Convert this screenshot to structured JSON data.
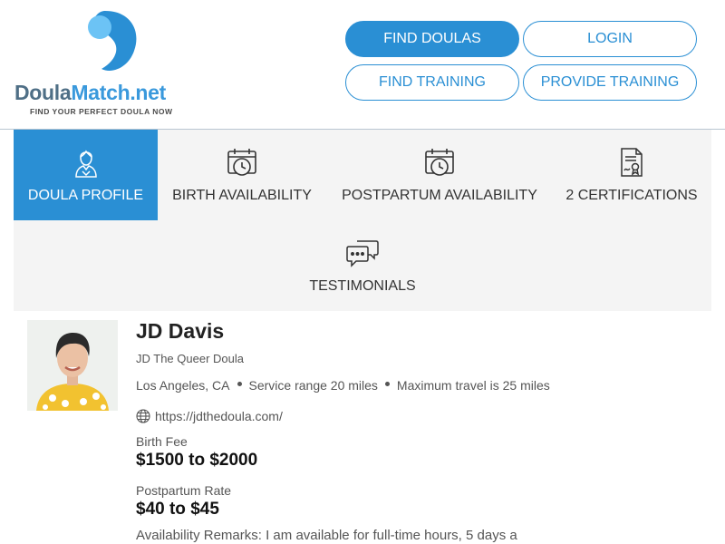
{
  "header": {
    "logo": {
      "name_part1": "Doula",
      "name_part2": "Match.net",
      "tagline": "FIND YOUR PERFECT DOULA NOW",
      "icon": "droplet-logo-icon"
    },
    "nav": {
      "find_doulas": "FIND DOULAS",
      "login": "LOGIN",
      "find_training": "FIND TRAINING",
      "provide_training": "PROVIDE TRAINING"
    }
  },
  "tabs": [
    {
      "label": "DOULA PROFILE",
      "icon": "doula-person-icon",
      "active": true
    },
    {
      "label": "BIRTH AVAILABILITY",
      "icon": "calendar-clock-icon",
      "active": false
    },
    {
      "label": "POSTPARTUM AVAILABILITY",
      "icon": "calendar-clock-icon",
      "active": false
    },
    {
      "label": "2 CERTIFICATIONS",
      "icon": "certificate-icon",
      "active": false
    },
    {
      "label": "TESTIMONIALS",
      "icon": "chat-bubbles-icon",
      "active": false
    }
  ],
  "profile": {
    "name": "JD Davis",
    "tagline": "JD The Queer Doula",
    "location": "Los Angeles, CA",
    "service_range": "Service range 20 miles",
    "max_travel": "Maximum travel is 25 miles",
    "website": "https://jdthedoula.com/",
    "birth_fee_label": "Birth Fee",
    "birth_fee": "$1500 to $2000",
    "postpartum_rate_label": "Postpartum Rate",
    "postpartum_rate": "$40 to $45",
    "availability_remarks": "Availability Remarks: I am available for full-time hours, 5 days a"
  },
  "colors": {
    "accent": "#2a8fd4",
    "logo_dark": "#4f6f86",
    "logo_light": "#3a99dc",
    "tab_bg": "#f4f4f4"
  }
}
